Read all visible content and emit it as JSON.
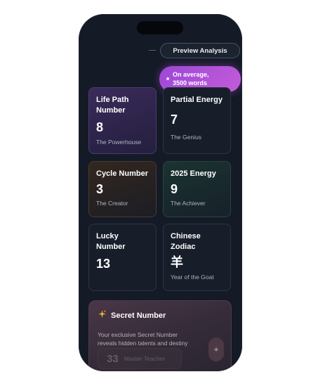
{
  "header": {
    "preview_label": "Preview Analysis",
    "bubble_line1": "On average,",
    "bubble_line2": "3500 words"
  },
  "cards": [
    {
      "title1": "Life Path",
      "title2": "Number",
      "number": "8",
      "subtitle": "The Powerhouse"
    },
    {
      "title1": "Partial Energy",
      "number": "7",
      "subtitle": "The Genius"
    },
    {
      "title1": "Cycle Number",
      "number": "3",
      "subtitle": "The Creator"
    },
    {
      "title1": "2025 Energy",
      "number": "9",
      "subtitle": "The Achiever"
    },
    {
      "title1": "Lucky",
      "title2": "Number",
      "number": "13",
      "subtitle": ""
    },
    {
      "title1": "Chinese",
      "title2": "Zodiac",
      "number": "羊",
      "subtitle": "Year of the Goat"
    }
  ],
  "secret": {
    "title": "Secret Number",
    "desc_line1": "Your exclusive Secret Number",
    "desc_line2": "reveals hidden talents and destiny",
    "number": "33",
    "label": "Master Teacher"
  },
  "colors": {
    "phone_bg": "#141a26",
    "accent_purple": "#9b47d6",
    "sparkle": "#f0b030"
  },
  "icons": {
    "secret_icon": "sparkle-icon",
    "fab_icon": "sparkle-icon"
  }
}
